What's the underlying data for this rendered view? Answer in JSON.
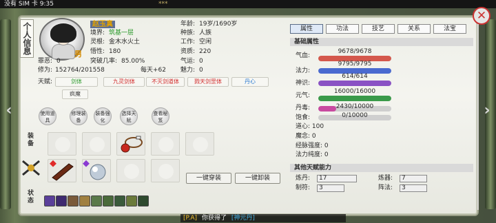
{
  "phone": {
    "status": "没有 SIM 卡 9:35",
    "top_notice": "***"
  },
  "panel": {
    "title": "个人信息"
  },
  "character": {
    "name": "赵玉真",
    "gender": "男",
    "realm_label": "境界:",
    "realm": "筑基一层",
    "root_label": "灵根:",
    "root": "金木水火土",
    "wuxing_label": "悟性:",
    "wuxing": "180",
    "age_label": "年龄:",
    "age": "19岁/1690岁",
    "race_label": "种族:",
    "race": "人族",
    "job_label": "工作:",
    "job": "空闲",
    "aptitude_label": "资质:",
    "aptitude": "220",
    "sin_label": "罪恶:",
    "sin": "0",
    "break_label": "突破几率:",
    "break": "85.00%",
    "qiyun_label": "气运:",
    "qiyun": "0",
    "cult_label": "修为:",
    "cultivation": "152764/201558",
    "daily": "每天+62",
    "charm_label": "魅力:",
    "charm": "0",
    "talent_label": "天赋:",
    "talents": [
      "剑体",
      "九灵剑体",
      "不灭剑道体",
      "戮天剑罡体",
      "丹心",
      "疯魔"
    ]
  },
  "skills": [
    "使用道具",
    "修理装备",
    "装备强化",
    "选择天赋",
    "查看秘笈"
  ],
  "equip": {
    "label": "装备",
    "equip_all": "一键穿装",
    "unequip_all": "一键卸装"
  },
  "status": {
    "label": "状态"
  },
  "tabs": [
    "属性",
    "功法",
    "技艺",
    "关系",
    "法宝"
  ],
  "attrs": {
    "basic_title": "基础属性",
    "hp_label": "气血:",
    "hp": "9678/9678",
    "mp_label": "法力:",
    "mp": "9795/9795",
    "sense_label": "神识:",
    "sense": "614/614",
    "yuanqi_label": "元气:",
    "yuanqi": "16000/16000",
    "poison_label": "丹毒:",
    "poison": "2430/10000",
    "hunger_label": "饱食:",
    "hunger": "0/10000",
    "daoxin_label": "道心: ",
    "daoxin": "100",
    "mo_label": "魔念: ",
    "mo": "0",
    "meridian_label": "经脉强度: ",
    "meridian": "0",
    "purity_label": "法力纯度: ",
    "purity": "0"
  },
  "abilities": {
    "title": "其他天赋能力",
    "dan_label": "炼丹:",
    "dan": "17",
    "qi_label": "炼器:",
    "qi": "7",
    "fu_label": "制符:",
    "fu": "3",
    "zhen_label": "阵法:",
    "zhen": "3"
  },
  "chat": {
    "tag": "[P.A]",
    "msg": "你获得了",
    "item": "[神元丹]"
  }
}
